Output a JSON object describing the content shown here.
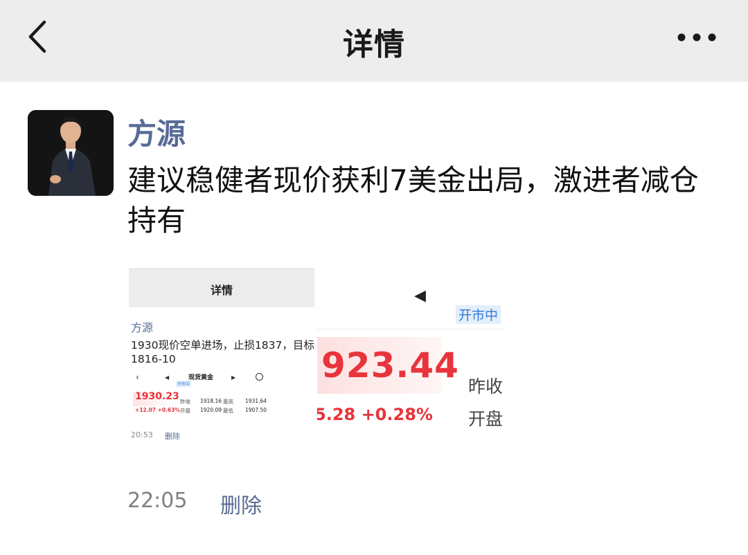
{
  "nav": {
    "title": "详情",
    "back_icon": "chevron-left-icon",
    "more_icon": "more-horizontal-icon"
  },
  "post": {
    "author": "方源",
    "text": "建议稳健者现价获利7美金出局，激进者减仓持有",
    "time": "22:05",
    "delete_label": "删除"
  },
  "attachments": {
    "image1": {
      "header_title": "详情",
      "author": "方源",
      "text_line1": "1930现价空单进场，止损1837，目标",
      "text_line2": "1816-10",
      "quote_title": "现货黄金",
      "status_badge": "开市中",
      "price": "1930.23",
      "change": "+12.07 +0.63%",
      "prev_close_label": "昨收",
      "prev_close": "1918.16",
      "high_label": "最高",
      "high": "1931.64",
      "open_label": "开盘",
      "open": "1920.09",
      "low_label": "最低",
      "low": "1907.50",
      "time": "20:53",
      "delete_label": "删除"
    },
    "image2": {
      "status_badge": "开市中",
      "price": "923.44",
      "change": "5.28 +0.28%",
      "prev_close_label": "昨收",
      "open_label": "开盘"
    }
  },
  "colors": {
    "link": "#576b95",
    "price_red": "#e8343c",
    "navbar_bg": "#ededed",
    "badge_blue": "#2f7bd8"
  }
}
